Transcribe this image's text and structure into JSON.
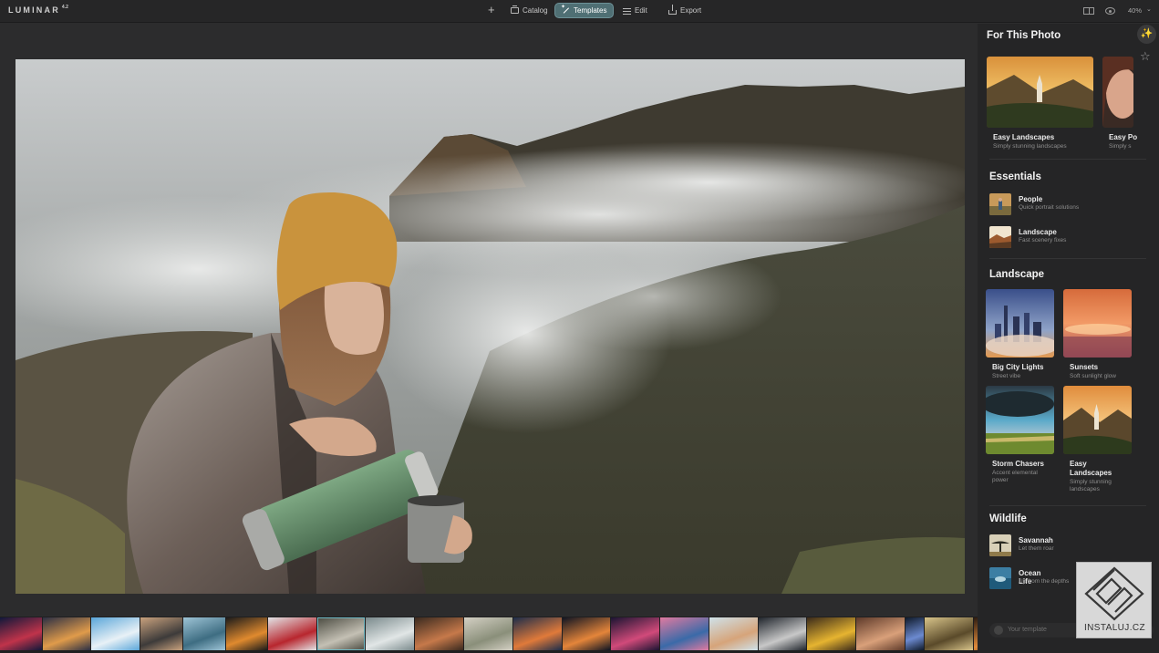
{
  "app": {
    "logo": "LUMINAR",
    "logo_version": "4.2"
  },
  "toolbar": {
    "catalog_label": "Catalog",
    "templates_label": "Templates",
    "edit_label": "Edit",
    "export_label": "Export",
    "zoom": "40%",
    "accent": "#4f6f74"
  },
  "panel": {
    "for_this_photo": {
      "title": "For This Photo",
      "cards": [
        {
          "name": "Easy Landscapes",
          "desc": "Simply stunning landscapes"
        },
        {
          "name": "Easy Po",
          "desc": "Simply s"
        }
      ]
    },
    "essentials": {
      "title": "Essentials",
      "items": [
        {
          "name": "People",
          "desc": "Quick portrait solutions"
        },
        {
          "name": "Landscape",
          "desc": "Fast scenery fixes"
        }
      ]
    },
    "landscape": {
      "title": "Landscape",
      "cards": [
        {
          "name": "Big City Lights",
          "desc": "Street vibe"
        },
        {
          "name": "Sunsets",
          "desc": "Soft sunlight glow"
        },
        {
          "name": "Storm Chasers",
          "desc": "Accent elemental power"
        },
        {
          "name": "Easy Landscapes",
          "desc": "Simply stunning landscapes"
        }
      ]
    },
    "wildlife": {
      "title": "Wildlife",
      "items": [
        {
          "name": "Savannah",
          "desc": "Let them roar"
        },
        {
          "name": "Ocean Life",
          "desc": "Up from the depths"
        }
      ]
    },
    "template_placeholder": "Your template"
  },
  "filmstrip": {
    "count": 22,
    "selected_index": 7
  },
  "watermark": {
    "text": "INSTALUJ.CZ"
  }
}
